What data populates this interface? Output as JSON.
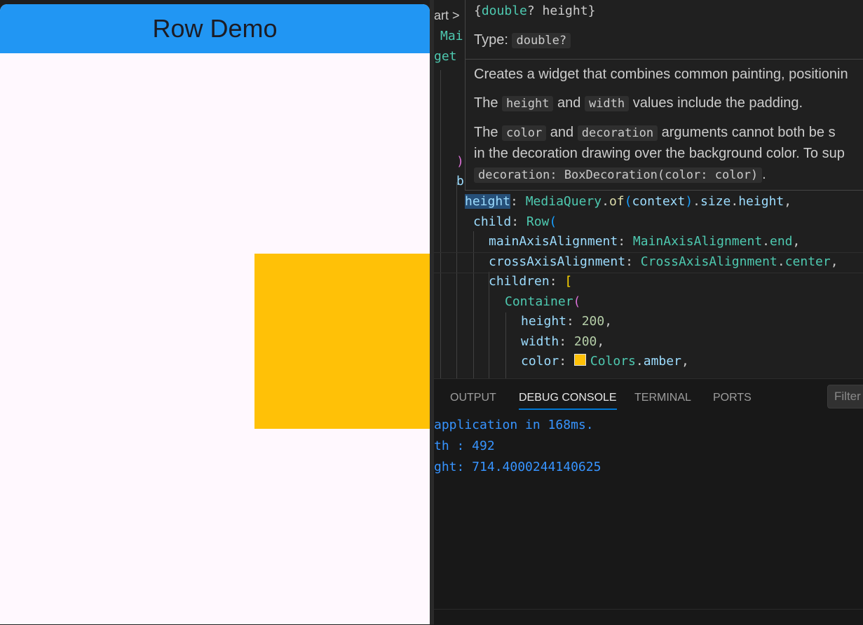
{
  "app": {
    "appbar_title": "Row Demo",
    "app_bar_color": "#2196f3",
    "body_color": "#fff8fe",
    "box_color": "#ffc107"
  },
  "editor": {
    "breadcrumb": "art >",
    "partial_lines": [
      {
        "text": "Mai",
        "color": "#4ec9b0"
      },
      {
        "text": "get",
        "color": "#4ec9b0"
      },
      {
        "text": ")",
        "color": "#da70d6"
      },
      {
        "text": "b",
        "color": "#9cdcfe"
      }
    ],
    "code": {
      "height_key": "height",
      "mediaquery": "MediaQuery",
      "of": "of",
      "context": "context",
      "size": "size",
      "height_prop": "height",
      "child_key": "child",
      "row": "Row",
      "main_key": "mainAxisAlignment",
      "main_type": "MainAxisAlignment",
      "main_val": "end",
      "cross_key": "crossAxisAlignment",
      "cross_type": "CrossAxisAlignment",
      "cross_val": "center",
      "children_key": "children",
      "container": "Container",
      "c_height_key": "height",
      "c_height_val": "200",
      "c_width_key": "width",
      "c_width_val": "200",
      "c_color_key": "color",
      "colors": "Colors",
      "amber": "amber"
    }
  },
  "hover": {
    "signature_open": "{",
    "signature_type": "double",
    "signature_rest": "? height}",
    "type_label": "Type:",
    "type_value": "double?",
    "desc_1": "Creates a widget that combines common painting, positionin",
    "desc_2_pre": "The",
    "desc_2_code1": "height",
    "desc_2_mid": "and",
    "desc_2_code2": "width",
    "desc_2_post": "values include the padding.",
    "desc_3_pre": "The",
    "desc_3_code1": "color",
    "desc_3_mid": "and",
    "desc_3_code2": "decoration",
    "desc_3_post": "arguments cannot both be s",
    "desc_4": "in the decoration drawing over the background color. To sup",
    "desc_5_code": "decoration: BoxDecoration(color: color)",
    "desc_5_post": "."
  },
  "panel": {
    "tabs": [
      "OUTPUT",
      "DEBUG CONSOLE",
      "TERMINAL",
      "PORTS"
    ],
    "active_tab": "DEBUG CONSOLE",
    "filter_placeholder": "Filter",
    "output_lines": [
      "application in 168ms.",
      "th : 492",
      "ght: 714.4000244140625"
    ]
  }
}
